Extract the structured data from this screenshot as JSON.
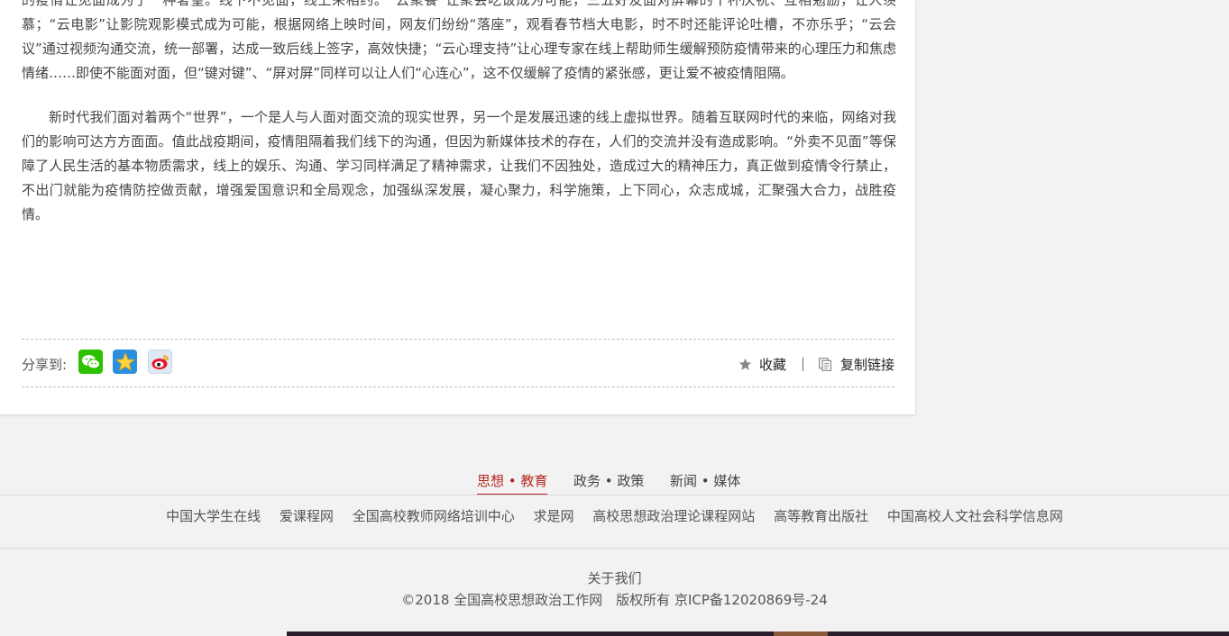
{
  "article": {
    "paragraphs": [
      "的疫情让见面成为了一种奢望。线下不见面，线上来相约。“云聚餐”让聚会吃饭成为可能，三五好友面对屏幕的干杯庆祝、互相勉励，让人羡慕；“云电影”让影院观影模式成为可能，根据网络上映时间，网友们纷纷“落座”，观看春节档大电影，时不时还能评论吐槽，不亦乐乎；“云会议”通过视频沟通交流，统一部署，达成一致后线上签字，高效快捷；“云心理支持”让心理专家在线上帮助师生缓解预防疫情带来的心理压力和焦虑情绪……即使不能面对面，但“键对键”、“屏对屏”同样可以让人们“心连心”，这不仅缓解了疫情的紧张感，更让爱不被疫情阻隔。",
      "新时代我们面对着两个“世界”，一个是人与人面对面交流的现实世界，另一个是发展迅速的线上虚拟世界。随着互联网时代的来临，网络对我们的影响可达方方面面。值此战疫期间，疫情阻隔着我们线下的沟通，但因为新媒体技术的存在，人们的交流并没有造成影响。“外卖不见面”等保障了人民生活的基本物质需求，线上的娱乐、沟通、学习同样满足了精神需求，让我们不因独处，造成过大的精神压力，真正做到疫情令行禁止，不出门就能为疫情防控做贡献，增强爱国意识和全局观念，加强纵深发展，凝心聚力，科学施策，上下同心，众志成城，汇聚强大合力，战胜疫情。"
    ]
  },
  "share": {
    "label": "分享到:",
    "icons": [
      "wechat-icon",
      "qzone-icon",
      "weibo-icon"
    ],
    "favorite_label": "收藏",
    "copy_link_label": "复制链接"
  },
  "footer": {
    "tabs": [
      {
        "label": "思想 • 教育",
        "active": true
      },
      {
        "label": "政务 • 政策",
        "active": false
      },
      {
        "label": "新闻 • 媒体",
        "active": false
      }
    ],
    "links": [
      "中国大学生在线",
      "爱课程网",
      "全国高校教师网络培训中心",
      "求是网",
      "高校思想政治理论课程网站",
      "高等教育出版社",
      "中国高校人文社会科学信息网"
    ],
    "about": "关于我们",
    "copyright": "©2018 全国高校思想政治工作网　版权所有 京ICP备12020869号-24"
  },
  "colors": {
    "accent": "#b5261e",
    "wechat": "#2dc100",
    "qzone": "#2b8fe0"
  }
}
